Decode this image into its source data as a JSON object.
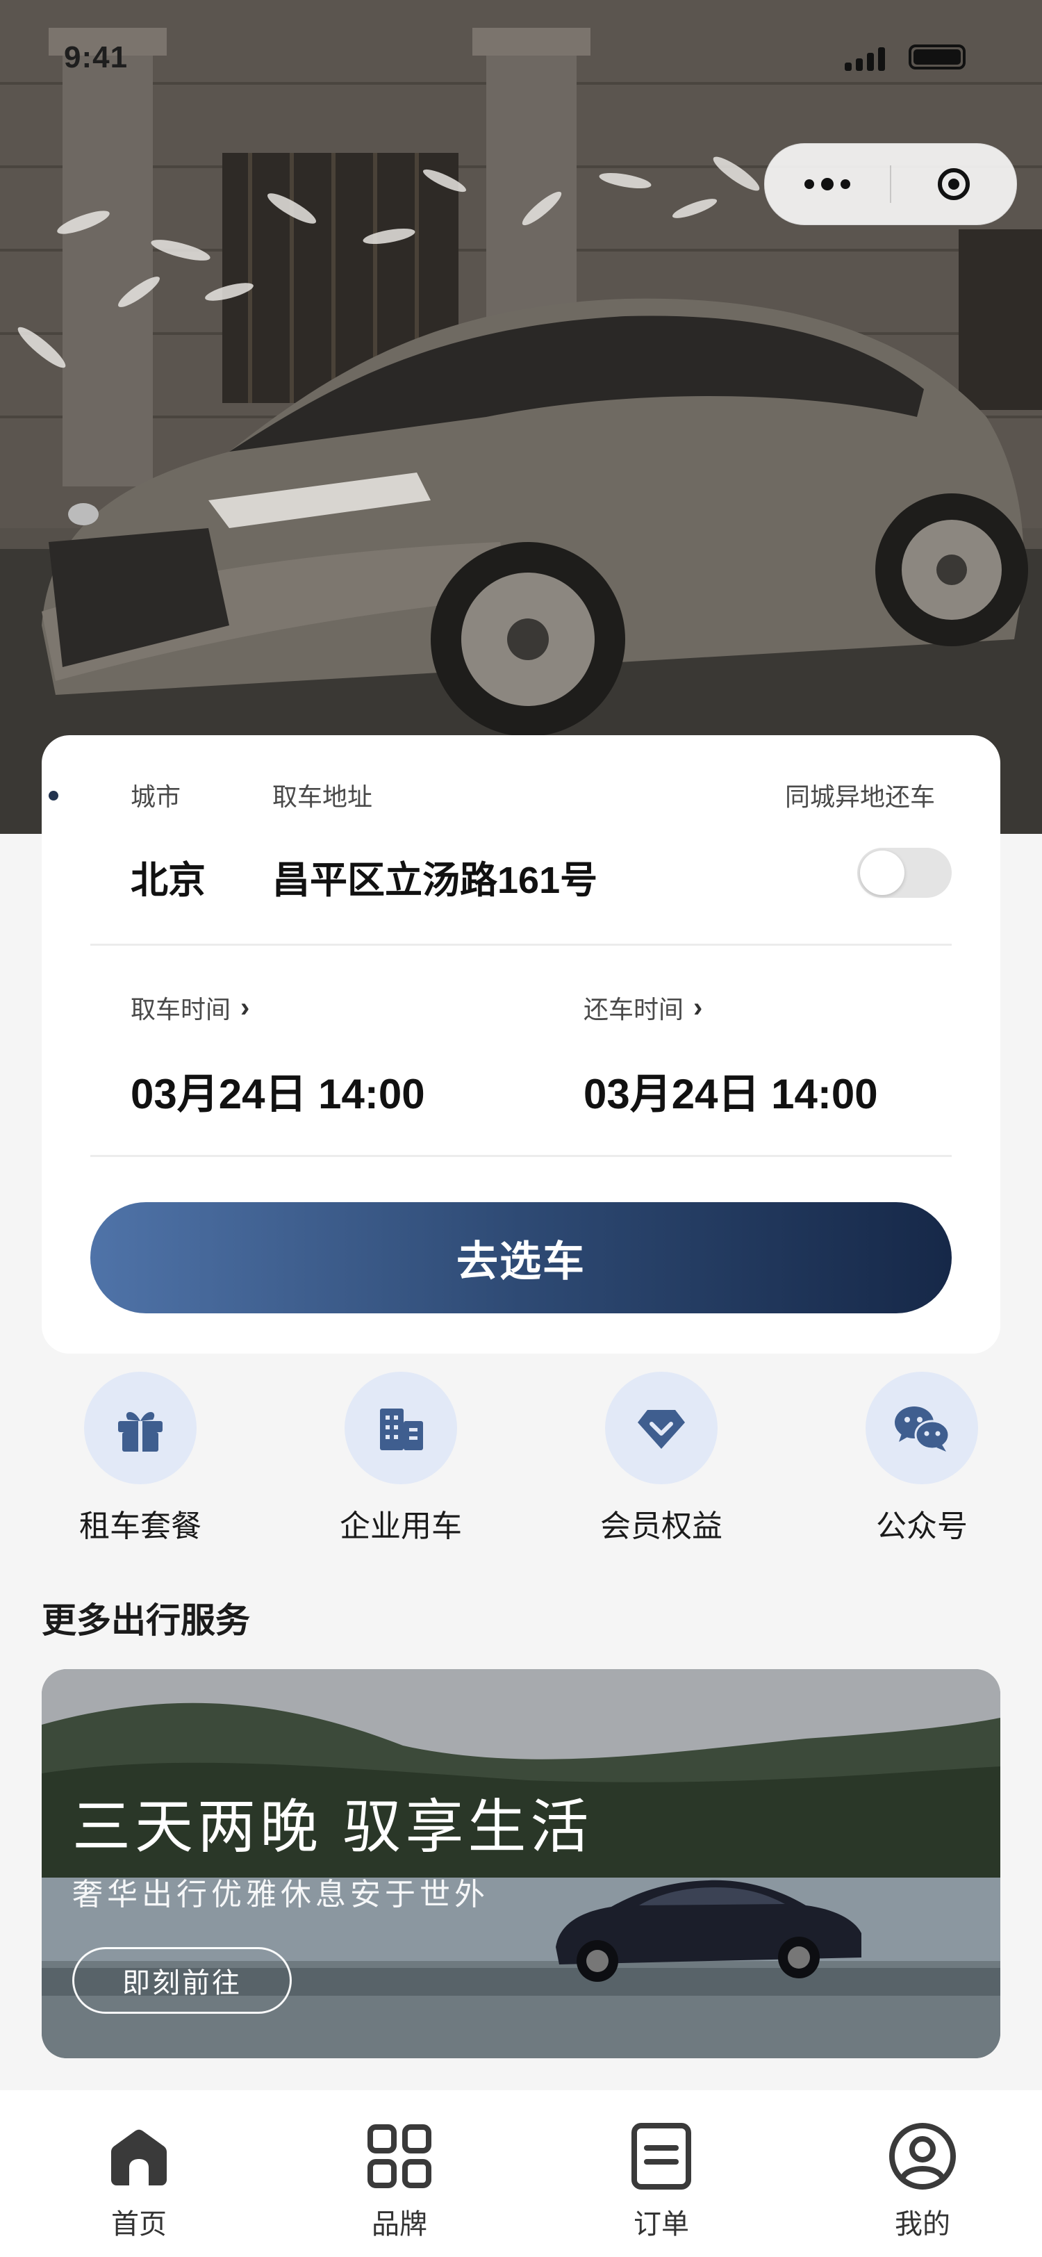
{
  "status_bar": {
    "time": "9:41"
  },
  "booking": {
    "city_label": "城市",
    "pickup_address_label": "取车地址",
    "return_elsewhere_label": "同城异地还车",
    "city_value": "北京",
    "address_value": "昌平区立汤路161号",
    "return_elsewhere_enabled": false,
    "pickup_time_label": "取车时间",
    "return_time_label": "还车时间",
    "pickup_time_value": "03月24日 14:00",
    "return_time_value": "03月24日 14:00",
    "chevron_icon": "chevron-right-icon",
    "go_button_label": "去选车"
  },
  "quick_actions": [
    {
      "label": "租车套餐",
      "icon": "gift-icon"
    },
    {
      "label": "企业用车",
      "icon": "building-icon"
    },
    {
      "label": "会员权益",
      "icon": "diamond-icon"
    },
    {
      "label": "公众号",
      "icon": "wechat-icon"
    }
  ],
  "more_services": {
    "title": "更多出行服务",
    "banner_title": "三天两晚 驭享生活",
    "banner_subtitle": "奢华出行优雅休息安于世外",
    "banner_button": "即刻前往"
  },
  "tab_bar": [
    {
      "label": "首页",
      "icon": "home-icon",
      "active": true
    },
    {
      "label": "品牌",
      "icon": "grid-icon",
      "active": false
    },
    {
      "label": "订单",
      "icon": "order-icon",
      "active": false
    },
    {
      "label": "我的",
      "icon": "profile-icon",
      "active": false
    }
  ],
  "colors": {
    "accent": "#2e4a74",
    "icon_bg": "#e2e9f7",
    "icon_fg": "#3f5e8f"
  }
}
